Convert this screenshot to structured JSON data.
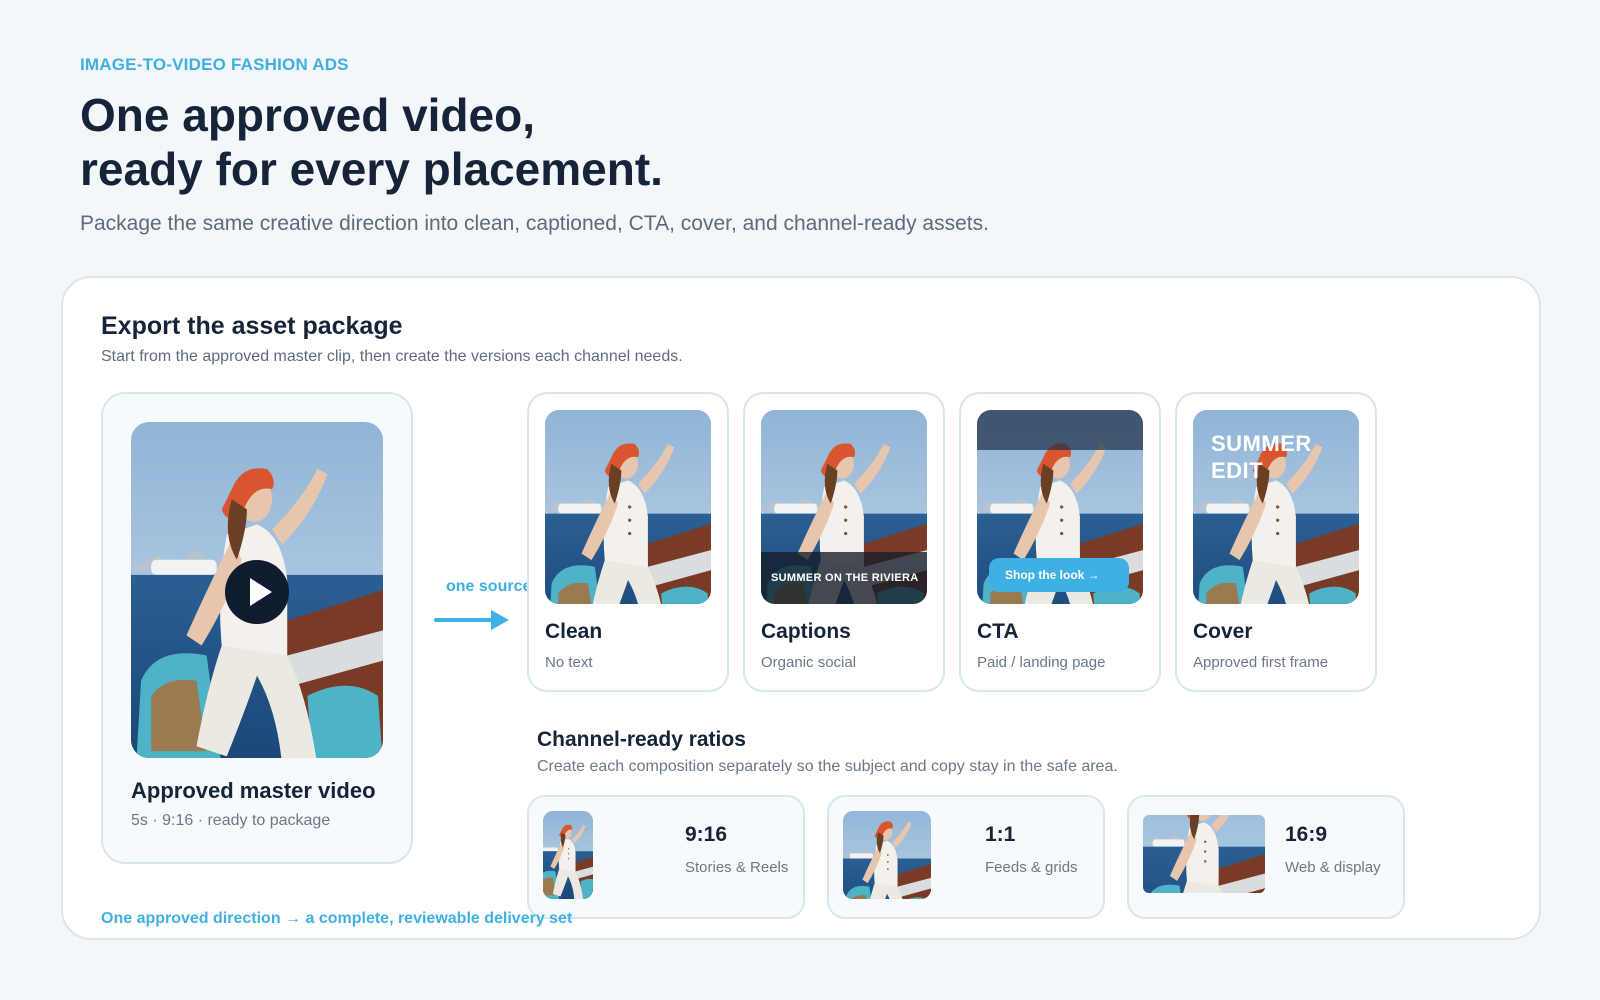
{
  "header": {
    "eyebrow": "IMAGE-TO-VIDEO FASHION ADS",
    "headline_line1": "One approved video,",
    "headline_line2": "ready for every placement.",
    "subhead": "Package the same creative direction into clean, captioned, CTA, cover, and channel-ready assets."
  },
  "panel": {
    "title": "Export the asset package",
    "subtitle": "Start from the approved master clip, then create the versions each channel needs.",
    "master": {
      "title": "Approved master video",
      "meta": "5s · 9:16 · ready to package",
      "icon": "play-icon"
    },
    "arrow_label": "one source",
    "variants": [
      {
        "title": "Clean",
        "subtitle": "No text"
      },
      {
        "title": "Captions",
        "subtitle": "Organic social",
        "overlay": "SUMMER ON THE RIVIERA"
      },
      {
        "title": "CTA",
        "subtitle": "Paid / landing page",
        "button": "Shop the look →"
      },
      {
        "title": "Cover",
        "subtitle": "Approved first frame",
        "overlay": "SUMMER EDIT"
      }
    ],
    "ratios": {
      "title": "Channel-ready ratios",
      "subtitle": "Create each composition separately so the subject and copy stay in the safe area.",
      "items": [
        {
          "ratio": "9:16",
          "label": "Stories & Reels"
        },
        {
          "ratio": "1:1",
          "label": "Feeds & grids"
        },
        {
          "ratio": "16:9",
          "label": "Web & display"
        }
      ]
    },
    "footer_note": "One approved direction → a complete, reviewable delivery set"
  },
  "colors": {
    "accent": "#3fb0e3",
    "heading": "#16243a",
    "muted": "#6b7888",
    "border": "#d8e6ee"
  }
}
